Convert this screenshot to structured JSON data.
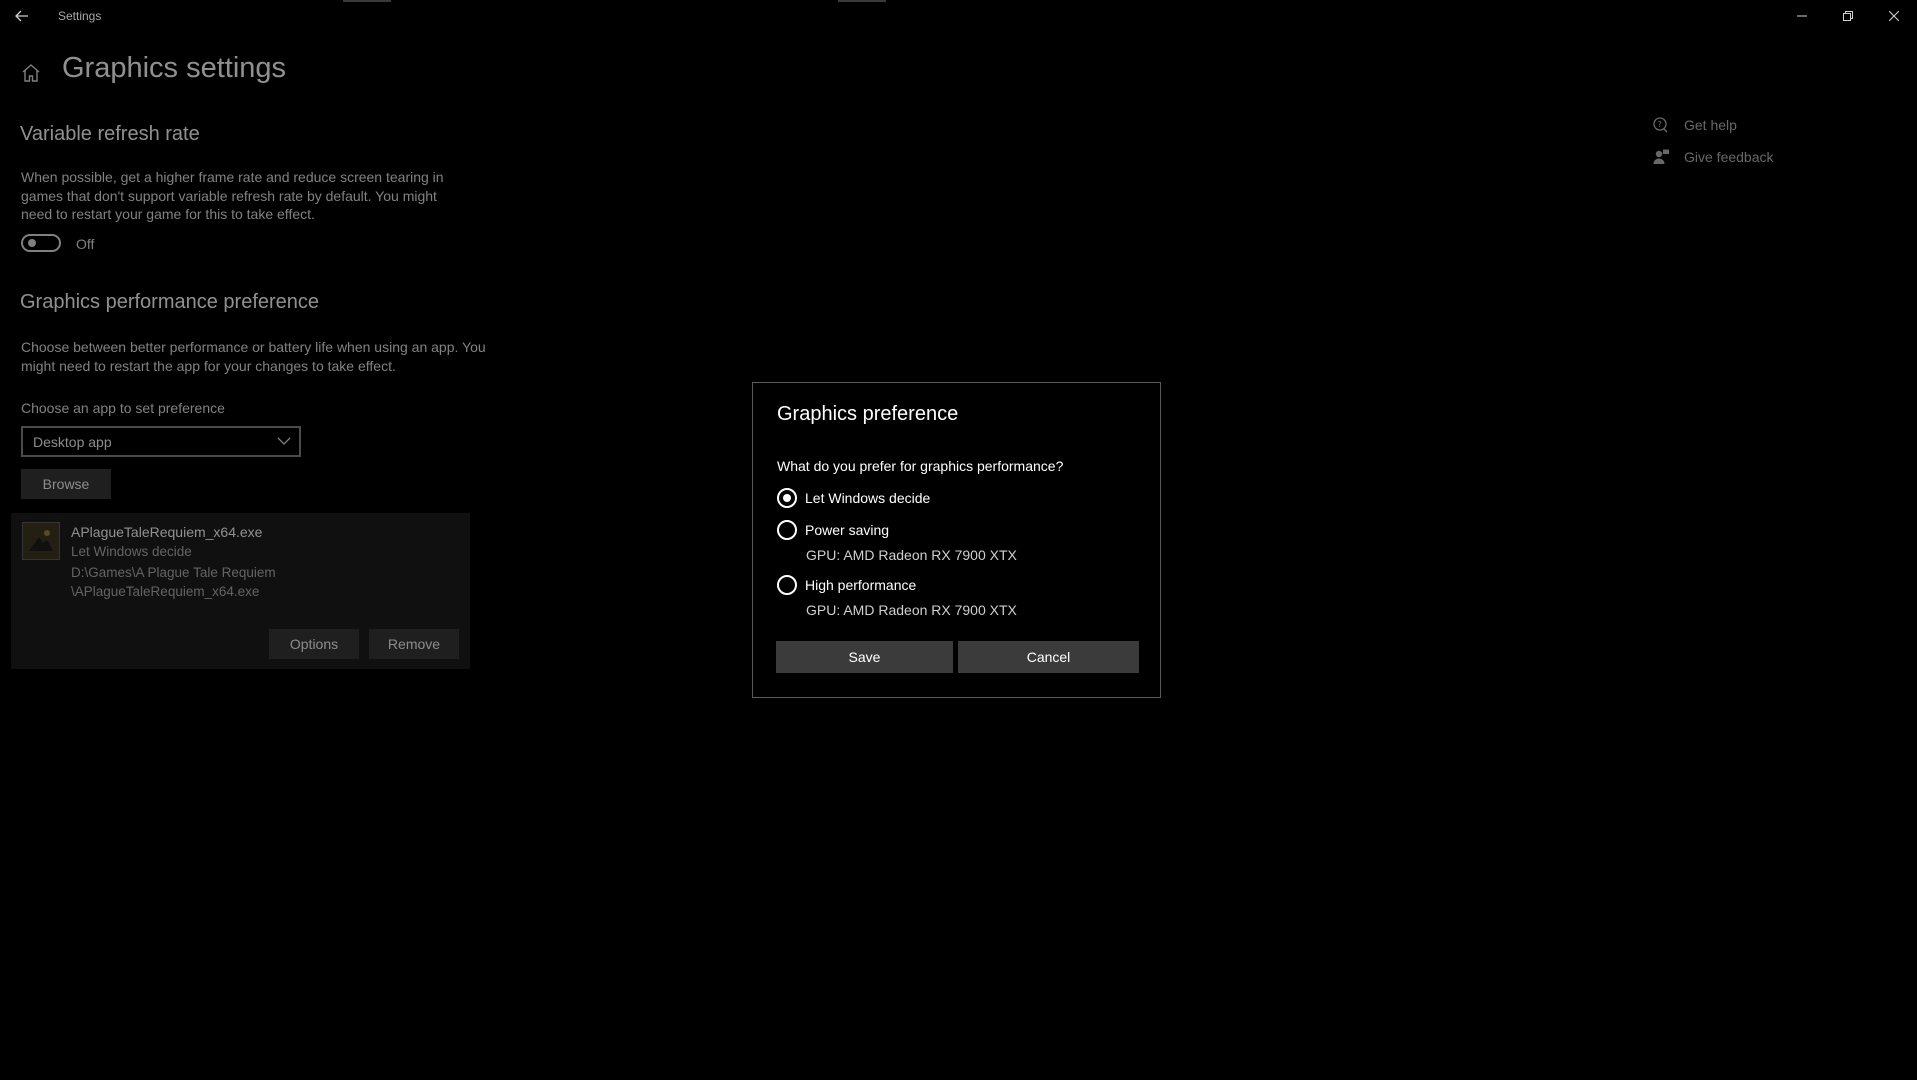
{
  "window": {
    "title": "Settings"
  },
  "page": {
    "title": "Graphics settings"
  },
  "vrr": {
    "heading": "Variable refresh rate",
    "description": "When possible, get a higher frame rate and reduce screen tearing in games that don't support variable refresh rate by default. You might need to restart your game for this to take effect.",
    "toggle_label": "Off"
  },
  "perf": {
    "heading": "Graphics performance preference",
    "description": "Choose between better performance or battery life when using an app. You might need to restart the app for your changes to take effect.",
    "choose_label": "Choose an app to set preference",
    "dropdown_value": "Desktop app",
    "browse_label": "Browse"
  },
  "app_entry": {
    "name": "APlagueTaleRequiem_x64.exe",
    "preference": "Let Windows decide",
    "path_line1": "D:\\Games\\A Plague Tale Requiem",
    "path_line2": "\\APlagueTaleRequiem_x64.exe",
    "options_label": "Options",
    "remove_label": "Remove"
  },
  "help": {
    "get_help": "Get help",
    "give_feedback": "Give feedback"
  },
  "dialog": {
    "title": "Graphics preference",
    "question": "What do you prefer for graphics performance?",
    "options": [
      {
        "label": "Let Windows decide",
        "checked": true
      },
      {
        "label": "Power saving",
        "gpu": "GPU: AMD Radeon RX 7900 XTX"
      },
      {
        "label": "High performance",
        "gpu": "GPU: AMD Radeon RX 7900 XTX"
      }
    ],
    "save_label": "Save",
    "cancel_label": "Cancel"
  }
}
